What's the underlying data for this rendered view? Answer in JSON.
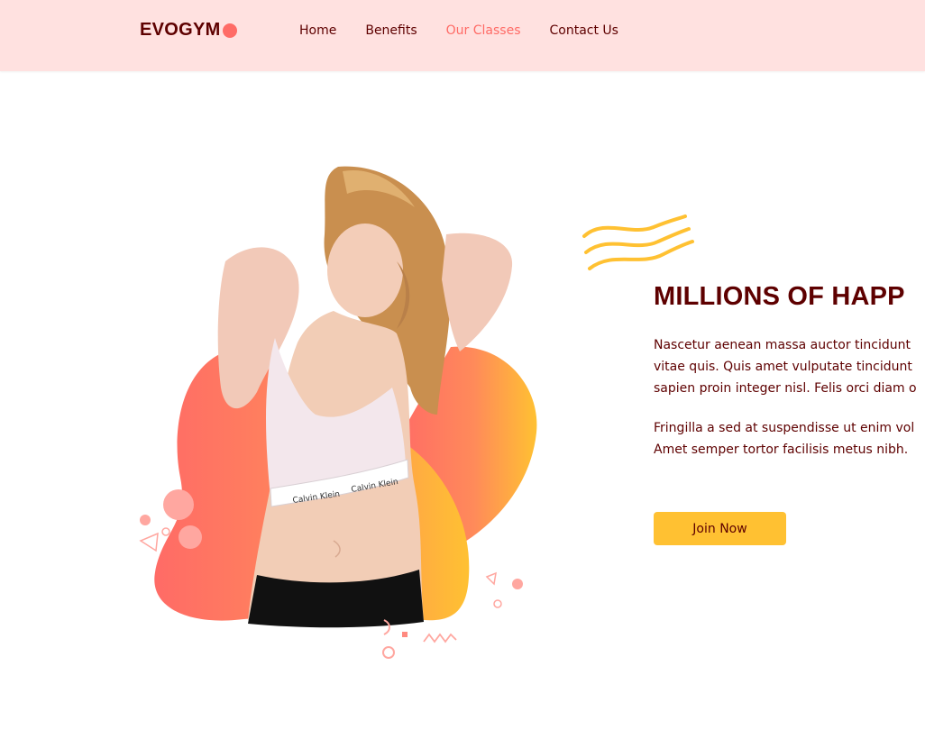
{
  "navbar": {
    "logo_text": "EVOGYM",
    "links": [
      {
        "label": "Home",
        "active": false
      },
      {
        "label": "Benefits",
        "active": false
      },
      {
        "label": "Our Classes",
        "active": true
      },
      {
        "label": "Contact Us",
        "active": false
      }
    ]
  },
  "hero": {
    "heading": "MILLIONS OF HAPP",
    "paragraph_1": [
      "Nascetur aenean massa auctor tincidunt",
      "vitae quis. Quis amet vulputate tincidunt",
      "sapien proin integer nisl. Felis orci diam o"
    ],
    "paragraph_2": [
      "Fringilla a sed at suspendisse ut enim vol",
      "Amet semper tortor facilisis metus nibh."
    ],
    "cta_label": "Join Now",
    "graphic_brand_text": [
      "Calvin Klein",
      "Calvin Klein"
    ]
  },
  "colors": {
    "nav_bg": "#ffe1e0",
    "primary_text": "#5e0000",
    "accent_red": "#ff6b66",
    "accent_yellow": "#ffc132"
  },
  "icons": [
    "logo-dot-icon",
    "wavy-lines-decoration",
    "confetti-decoration"
  ]
}
